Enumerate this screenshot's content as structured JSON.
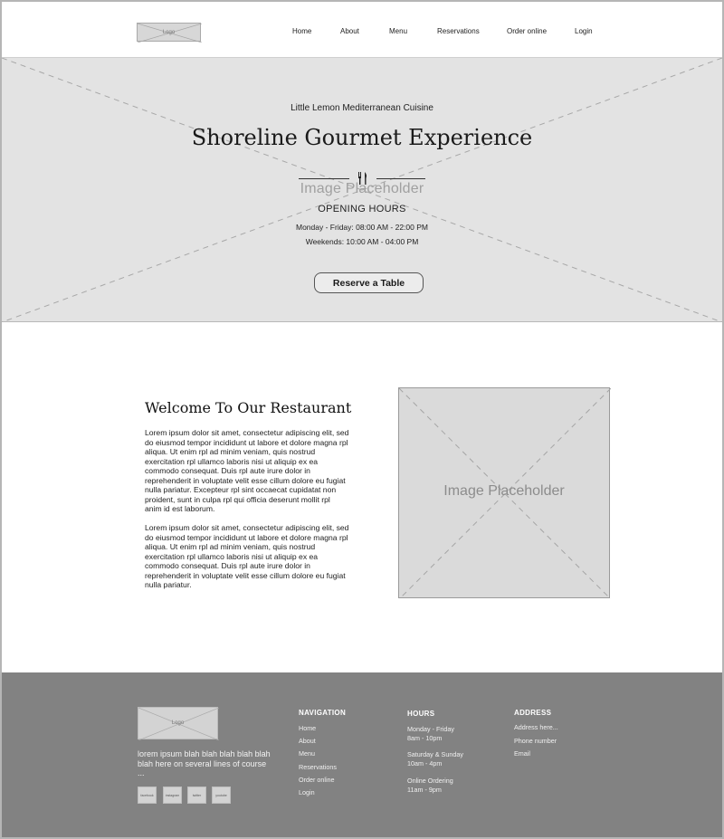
{
  "header": {
    "logo_label": "Logo",
    "nav": [
      "Home",
      "About",
      "Menu",
      "Reservations",
      "Order online",
      "Login"
    ]
  },
  "hero": {
    "subtitle": "Little Lemon Mediterranean Cuisine",
    "title": "Shoreline Gourmet Experience",
    "image_placeholder": "Image Placeholder",
    "hours_title": "OPENING HOURS",
    "hours_weekdays": "Monday - Friday: 08:00 AM - 22:00 PM",
    "hours_weekends": "Weekends: 10:00 AM - 04:00 PM",
    "cta_label": "Reserve a Table",
    "icon": "fork-knife-icon"
  },
  "welcome": {
    "title": "Welcome To Our Restaurant",
    "paragraph1_lines": [
      "Lorem ipsum dolor sit amet, consectetur adipiscing elit, sed",
      "do eiusmod tempor incididunt ut labore et dolore magna rpl",
      "aliqua. Ut enim rpl ad minim veniam, quis nostrud",
      "exercitation rpl ullamco laboris nisi ut aliquip ex ea",
      "commodo consequat. Duis rpl aute irure dolor in",
      "reprehenderit in voluptate velit esse cillum dolore eu fugiat",
      "nulla pariatur. Excepteur rpl sint occaecat cupidatat non",
      "proident, sunt in culpa rpl qui officia deserunt mollit rpl",
      "anim id est laborum."
    ],
    "paragraph2_lines": [
      "Lorem ipsum dolor sit amet, consectetur adipiscing elit, sed",
      "do eiusmod tempor incididunt ut labore et dolore magna rpl",
      "aliqua. Ut enim rpl ad minim veniam, quis nostrud",
      "exercitation rpl ullamco laboris nisi ut aliquip ex ea",
      "commodo consequat. Duis rpl aute irure dolor in",
      "reprehenderit in voluptate velit esse cillum dolore eu fugiat",
      "nulla pariatur."
    ],
    "image_placeholder": "Image Placeholder"
  },
  "footer": {
    "logo_label": "Logo",
    "tagline": "lorem ipsum blah blah blah blah blah blah here on several lines of course ...",
    "social": [
      "facebook",
      "instagram",
      "twitter",
      "youtube"
    ],
    "navigation": {
      "heading": "NAVIGATION",
      "links": [
        "Home",
        "About",
        "Menu",
        "Reservations",
        "Order online",
        "Login"
      ]
    },
    "hours": {
      "heading": "HOURS",
      "weekday_days": "Monday - Friday",
      "weekday_time": "8am - 10pm",
      "weekend_days": "Saturday & Sunday",
      "weekend_time": "10am - 4pm",
      "online_label": "Online Ordering",
      "online_time": "11am - 9pm"
    },
    "address": {
      "heading": "ADDRESS",
      "lines": [
        "Address here...",
        "Phone number",
        "Email"
      ]
    }
  },
  "colors": {
    "hero_bg": "#e3e3e3",
    "footer_bg": "#828282",
    "placeholder_bg": "#dadada"
  }
}
